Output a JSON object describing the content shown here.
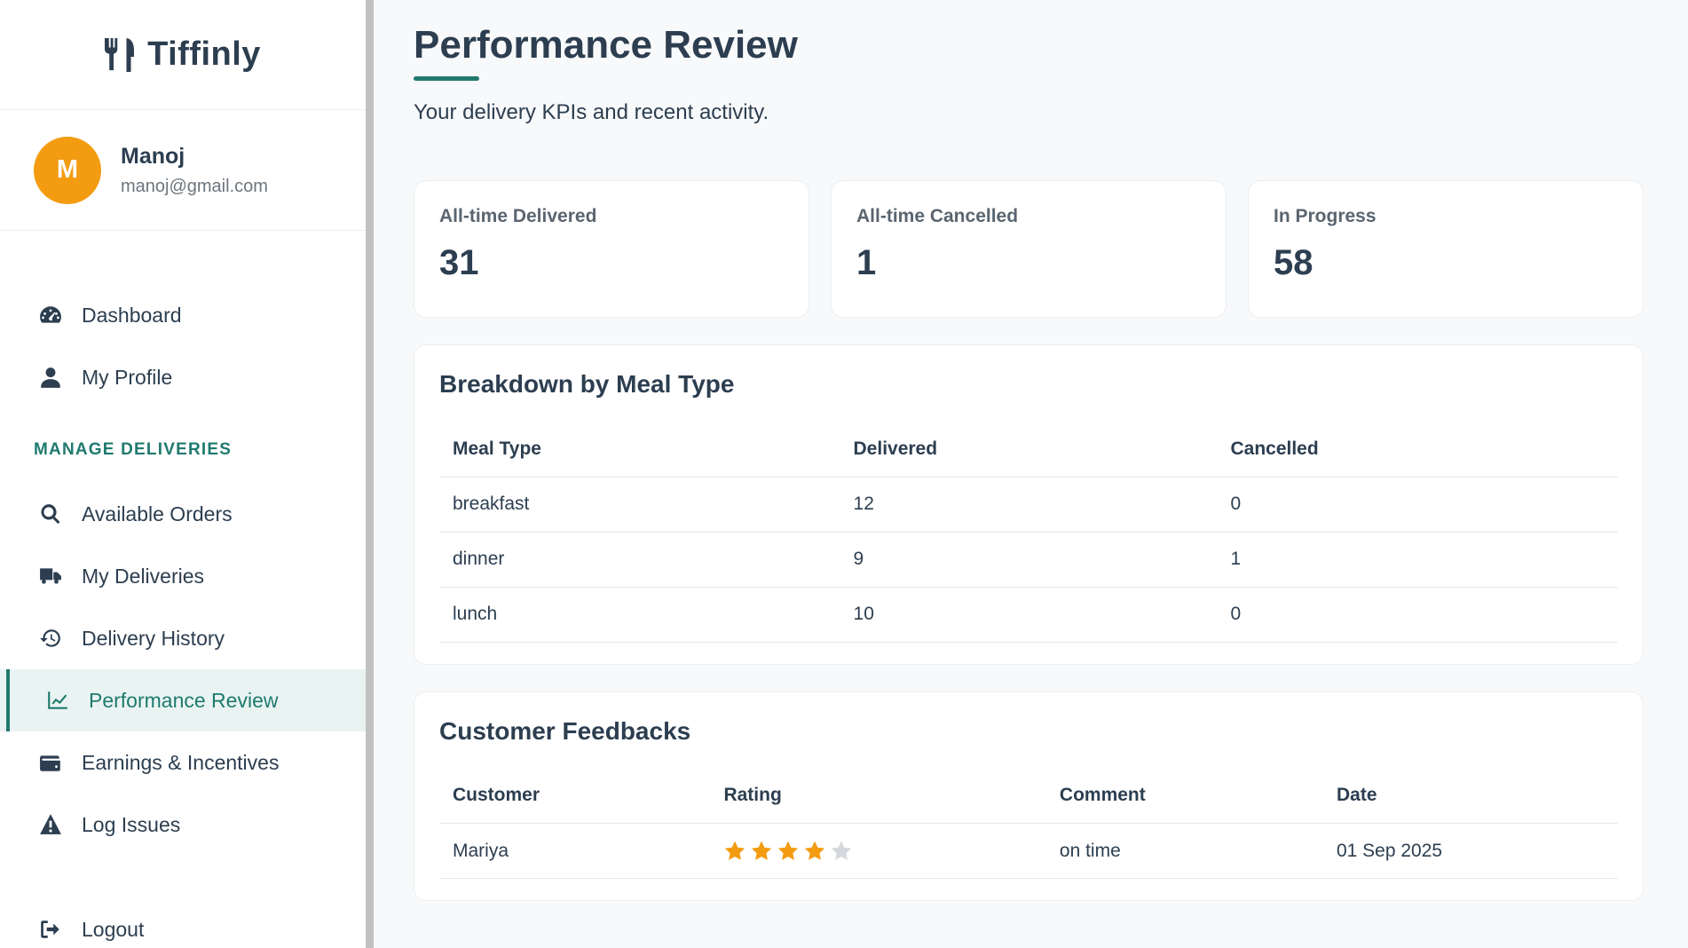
{
  "brand": {
    "name": "Tiffinly",
    "icon": "utensils-icon"
  },
  "user": {
    "initial": "M",
    "name": "Manoj",
    "email": "manoj@gmail.com",
    "avatar_color": "#f39c12"
  },
  "nav": {
    "top_items": [
      {
        "label": "Dashboard",
        "icon": "dashboard-gauge-icon"
      },
      {
        "label": "My Profile",
        "icon": "user-icon"
      }
    ],
    "section_title": "MANAGE DELIVERIES",
    "section_items": [
      {
        "label": "Available Orders",
        "icon": "search-icon"
      },
      {
        "label": "My Deliveries",
        "icon": "truck-icon"
      },
      {
        "label": "Delivery History",
        "icon": "history-icon"
      },
      {
        "label": "Performance Review",
        "icon": "chart-line-icon",
        "active": true
      },
      {
        "label": "Earnings & Incentives",
        "icon": "wallet-icon"
      },
      {
        "label": "Log Issues",
        "icon": "warning-icon"
      }
    ],
    "logout": {
      "label": "Logout",
      "icon": "logout-icon"
    }
  },
  "page": {
    "title": "Performance Review",
    "subtitle": "Your delivery KPIs and recent activity."
  },
  "kpis": [
    {
      "label": "All-time Delivered",
      "value": "31"
    },
    {
      "label": "All-time Cancelled",
      "value": "1"
    },
    {
      "label": "In Progress",
      "value": "58"
    }
  ],
  "meal_breakdown": {
    "title": "Breakdown by Meal Type",
    "headers": [
      "Meal Type",
      "Delivered",
      "Cancelled"
    ],
    "rows": [
      [
        "breakfast",
        "12",
        "0"
      ],
      [
        "dinner",
        "9",
        "1"
      ],
      [
        "lunch",
        "10",
        "0"
      ]
    ]
  },
  "feedbacks": {
    "title": "Customer Feedbacks",
    "headers": [
      "Customer",
      "Rating",
      "Comment",
      "Date"
    ],
    "rows": [
      {
        "customer": "Mariya",
        "rating": 4,
        "rating_max": 5,
        "comment": "on time",
        "date": "01 Sep 2025"
      }
    ]
  },
  "colors": {
    "accent": "#1f7a6e",
    "star_filled": "#f39c12",
    "star_empty": "#d5d8dc",
    "text": "#2c3e50"
  }
}
